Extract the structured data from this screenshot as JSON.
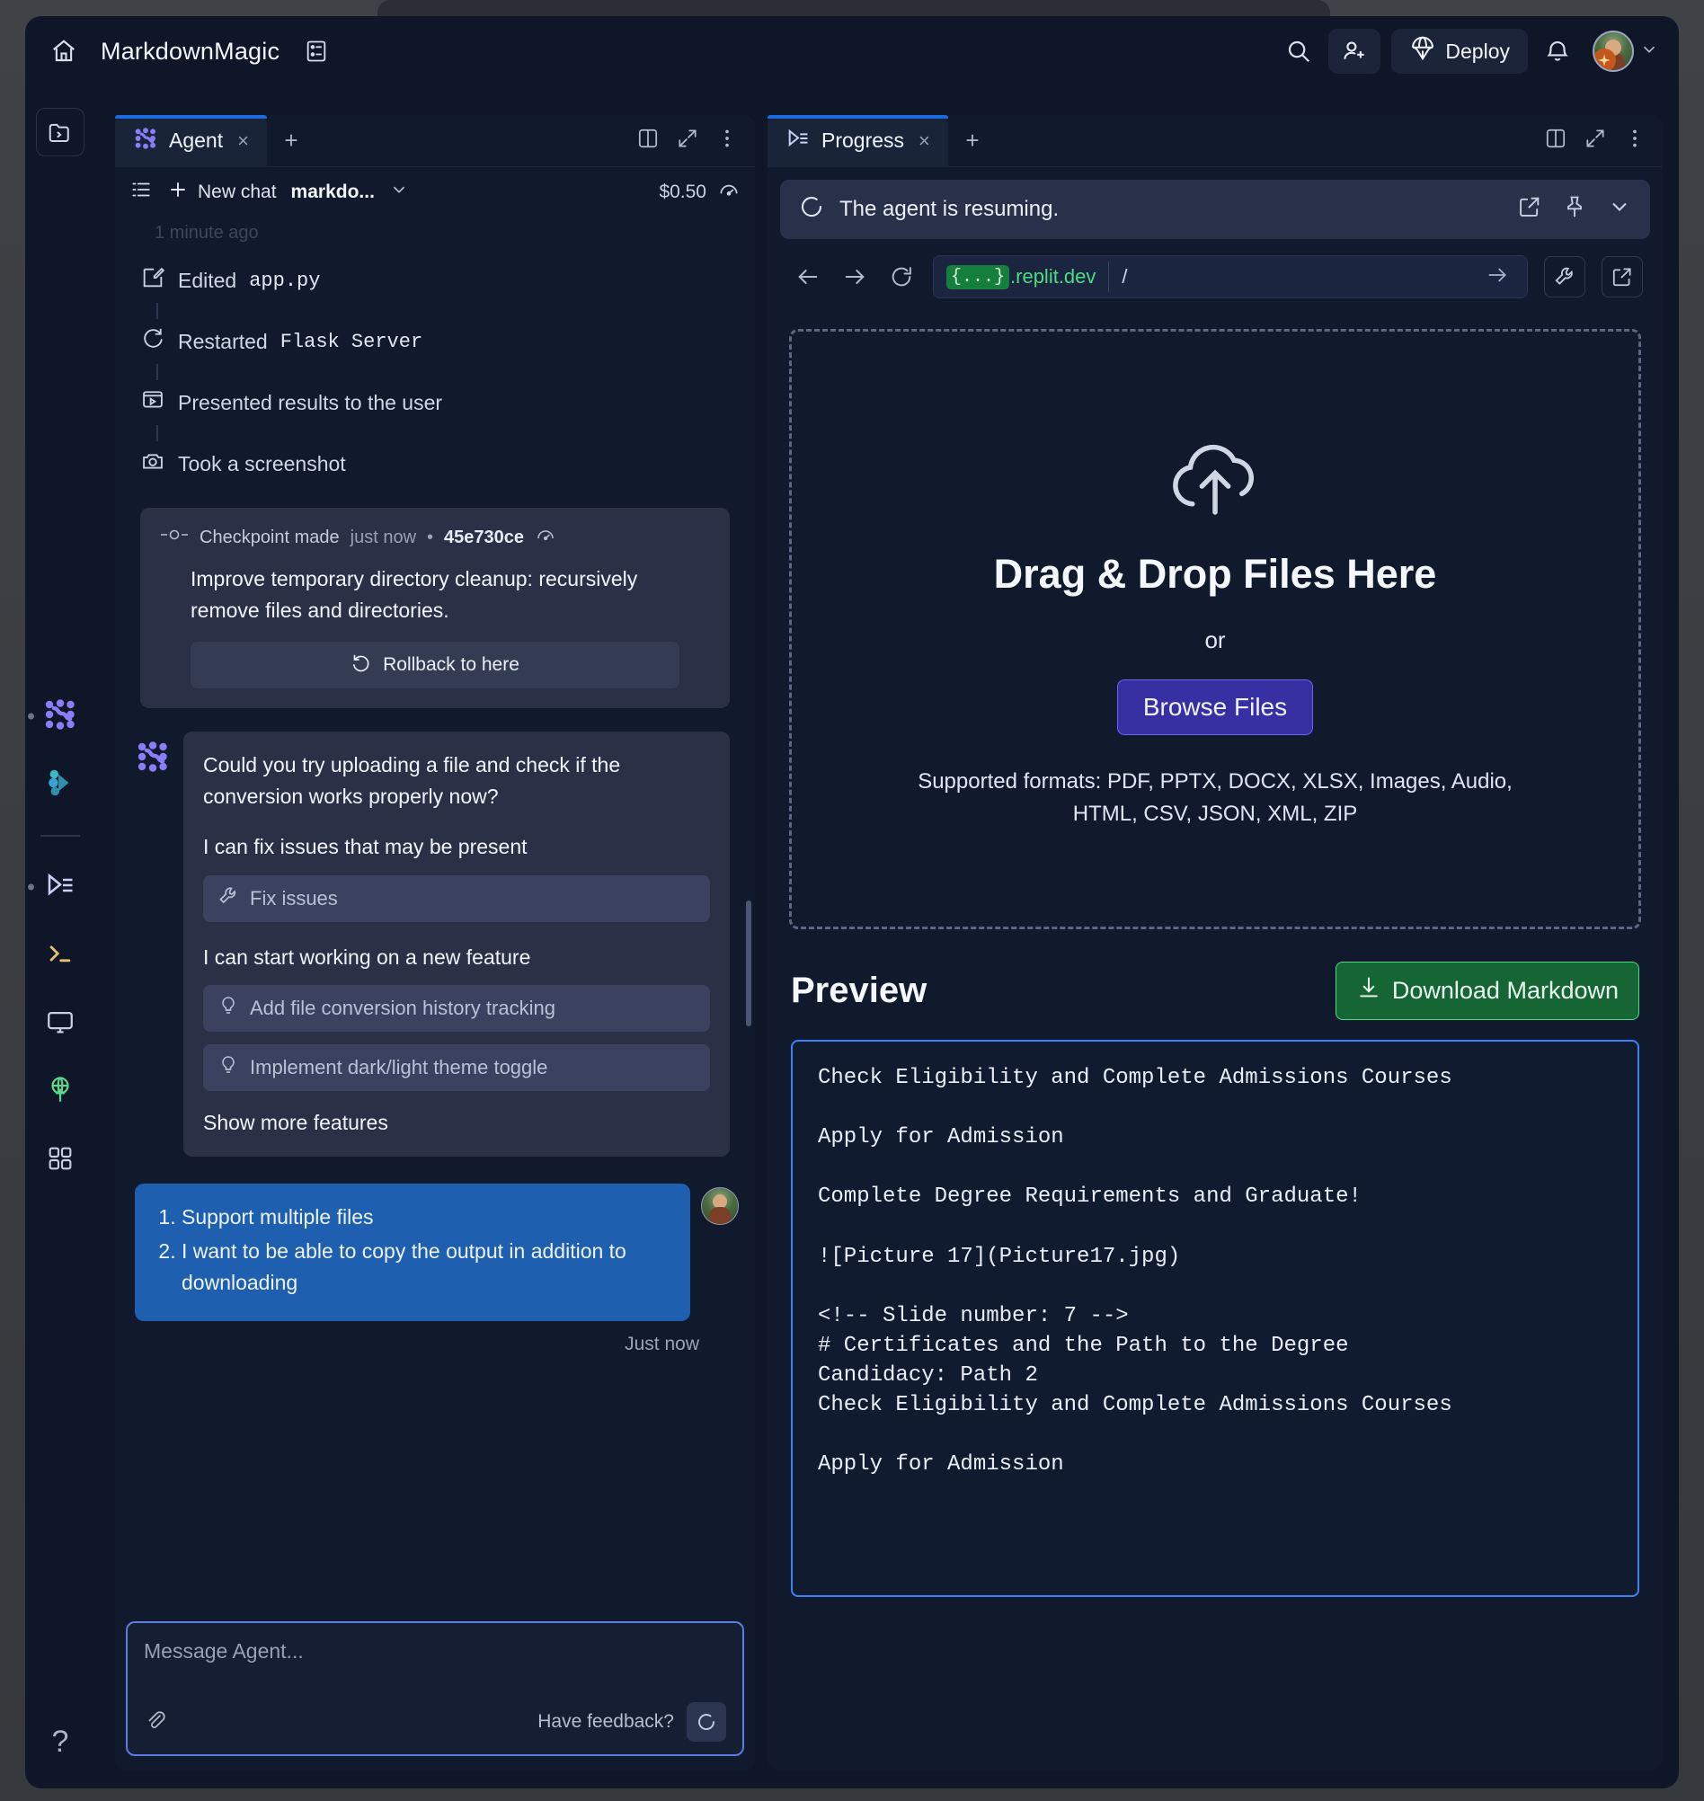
{
  "topbar": {
    "home_icon": "home-icon",
    "app_title": "MarkdownMagic",
    "panes_icon": "panels-icon",
    "search_icon": "search-icon",
    "invite_icon": "add-user-icon",
    "deploy_label": "Deploy",
    "deploy_icon": "deploy-parachute-icon",
    "bell_icon": "bell-icon",
    "avatar_icon": "user-avatar",
    "chevron_icon": "chevron-down-icon"
  },
  "rail": {
    "folder_icon": "files-icon",
    "items": [
      {
        "name": "agent-icon",
        "dot": true
      },
      {
        "name": "workflows-icon",
        "dot": false
      },
      {
        "name": "progress-icon",
        "dot": true
      },
      {
        "name": "shell-icon",
        "dot": false
      },
      {
        "name": "screen-icon",
        "dot": false
      },
      {
        "name": "deployments-icon",
        "dot": false
      },
      {
        "name": "apps-grid-icon",
        "dot": false
      }
    ],
    "help_label": "?"
  },
  "left_panel": {
    "tab": {
      "label": "Agent",
      "icon": "agent-icon",
      "close": "×",
      "add": "+"
    },
    "actions": {
      "split_icon": "split-pane-icon",
      "expand_icon": "expand-icon",
      "more_icon": "more-vertical-icon"
    },
    "subbar": {
      "history_icon": "history-list-icon",
      "new_chat_label": "New chat",
      "new_chat_icon": "plus-icon",
      "model_label": "markdo...",
      "model_chevron": "chevron-down-icon",
      "cost_label": "$0.50",
      "usage_icon": "gauge-icon"
    },
    "faded_time": "1 minute ago",
    "timeline": [
      {
        "icon": "edit-file-icon",
        "prefix": "Edited ",
        "mono": "app.py"
      },
      {
        "icon": "restart-icon",
        "prefix": "Restarted ",
        "mono": "Flask Server"
      },
      {
        "icon": "present-icon",
        "prefix": "Presented results to the user",
        "mono": ""
      },
      {
        "icon": "camera-icon",
        "prefix": "Took a screenshot",
        "mono": ""
      }
    ],
    "checkpoint": {
      "icon": "checkpoint-node-icon",
      "label": "Checkpoint made",
      "time": "just now",
      "dot": "•",
      "hash": "45e730ce",
      "usage_icon": "gauge-icon",
      "description": "Improve temporary directory cleanup: recursively remove files and directories.",
      "rollback_label": "Rollback to here",
      "rollback_icon": "undo-icon"
    },
    "agent_message": {
      "avatar_icon": "agent-icon",
      "question": "Could you try uploading a file and check if the conversion works properly now?",
      "fix_heading": "I can fix issues that may be present",
      "fix_suggestion": {
        "icon": "wrench-icon",
        "label": "Fix issues"
      },
      "feature_heading": "I can start working on a new feature",
      "feature_suggestions": [
        {
          "icon": "lightbulb-icon",
          "label": "Add file conversion history tracking"
        },
        {
          "icon": "lightbulb-icon",
          "label": "Implement dark/light theme toggle"
        }
      ],
      "show_more_label": "Show more features"
    },
    "user_message": {
      "items": [
        "Support multiple files",
        "I want to be able to copy the output in addition to downloading"
      ],
      "timestamp": "Just now",
      "avatar_icon": "user-avatar"
    },
    "composer": {
      "placeholder": "Message Agent...",
      "attach_icon": "paperclip-icon",
      "feedback_label": "Have feedback?",
      "send_icon": "stop-spinner-icon"
    }
  },
  "right_panel": {
    "tab": {
      "label": "Progress",
      "icon": "progress-icon",
      "close": "×",
      "add": "+"
    },
    "actions": {
      "split_icon": "split-pane-icon",
      "expand_icon": "expand-icon",
      "more_icon": "more-vertical-icon"
    },
    "status": {
      "spinner_icon": "loading-spinner-icon",
      "text": "The agent is resuming.",
      "open_icon": "open-external-icon",
      "pin_icon": "pin-icon",
      "collapse_icon": "chevron-down-icon"
    },
    "urlbar": {
      "back_icon": "arrow-left-icon",
      "forward_icon": "arrow-right-icon",
      "reload_icon": "reload-icon",
      "host_brace": "{...}",
      "host_suffix": ".replit.dev",
      "path": "/",
      "go_icon": "arrow-right-icon",
      "devtools_icon": "wrench-icon",
      "popout_icon": "open-external-icon"
    },
    "webview": {
      "dropzone": {
        "upload_icon": "cloud-upload-icon",
        "title": "Drag & Drop Files Here",
        "or": "or",
        "browse_label": "Browse Files",
        "formats": "Supported formats: PDF, PPTX, DOCX, XLSX, Images, Audio, HTML, CSV, JSON, XML, ZIP"
      },
      "preview": {
        "title": "Preview",
        "download_label": "Download Markdown",
        "download_icon": "download-icon",
        "code": "Check Eligibility and Complete Admissions Courses\n\nApply for Admission\n\nComplete Degree Requirements and Graduate!\n\n![Picture 17](Picture17.jpg)\n\n<!-- Slide number: 7 -->\n# Certificates and the Path to the Degree\nCandidacy: Path 2\nCheck Eligibility and Complete Admissions Courses\n\nApply for Admission"
      }
    }
  },
  "colors": {
    "accent_blue": "#1b6ae0",
    "agent_purple": "#8b7cf8",
    "deploy_green": "#4ade80",
    "user_bubble": "#1e5fb0",
    "browse_indigo": "#3730a3"
  }
}
